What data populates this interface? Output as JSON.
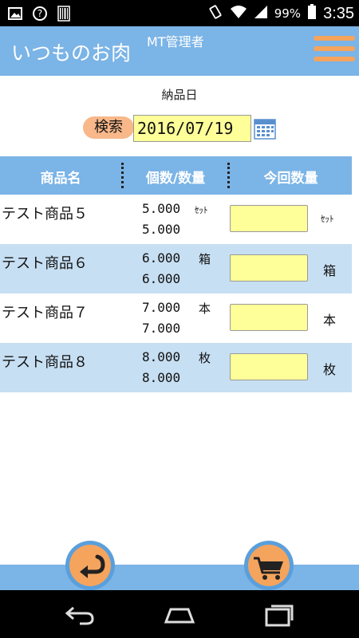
{
  "status_bar": {
    "battery": "99%",
    "time": "3:35",
    "icons": [
      "image-icon",
      "question-circle-icon",
      "barcode-icon",
      "vibrate-icon",
      "wifi-icon",
      "signal-icon",
      "battery-icon"
    ]
  },
  "header": {
    "title": "いつものお肉",
    "user": "MT管理者",
    "menu_icon": "hamburger-menu-icon"
  },
  "search": {
    "date_label": "納品日",
    "button_label": "検索",
    "date_value": "2016/07/19",
    "calendar_icon": "calendar-icon"
  },
  "table": {
    "columns": [
      "商品名",
      "個数/数量",
      "今回数量"
    ],
    "rows": [
      {
        "name": "テスト商品５",
        "qty1": "5.000",
        "qty2": "5.000",
        "unit": "ｾｯﾄ",
        "current": ""
      },
      {
        "name": "テスト商品６",
        "qty1": "6.000",
        "qty2": "6.000",
        "unit": "箱",
        "current": ""
      },
      {
        "name": "テスト商品７",
        "qty1": "7.000",
        "qty2": "7.000",
        "unit": "本",
        "current": ""
      },
      {
        "name": "テスト商品８",
        "qty1": "8.000",
        "qty2": "8.000",
        "unit": "枚",
        "current": ""
      }
    ]
  },
  "footer": {
    "back_icon": "back-arrow-icon",
    "cart_icon": "shopping-cart-icon"
  },
  "nav": {
    "icons": [
      "nav-back-icon",
      "nav-home-icon",
      "nav-recents-icon"
    ]
  },
  "colors": {
    "accent": "#7bb4e6",
    "row_alt": "#c7dff3",
    "input_bg": "#ffff99",
    "orange": "#f5a45d"
  }
}
